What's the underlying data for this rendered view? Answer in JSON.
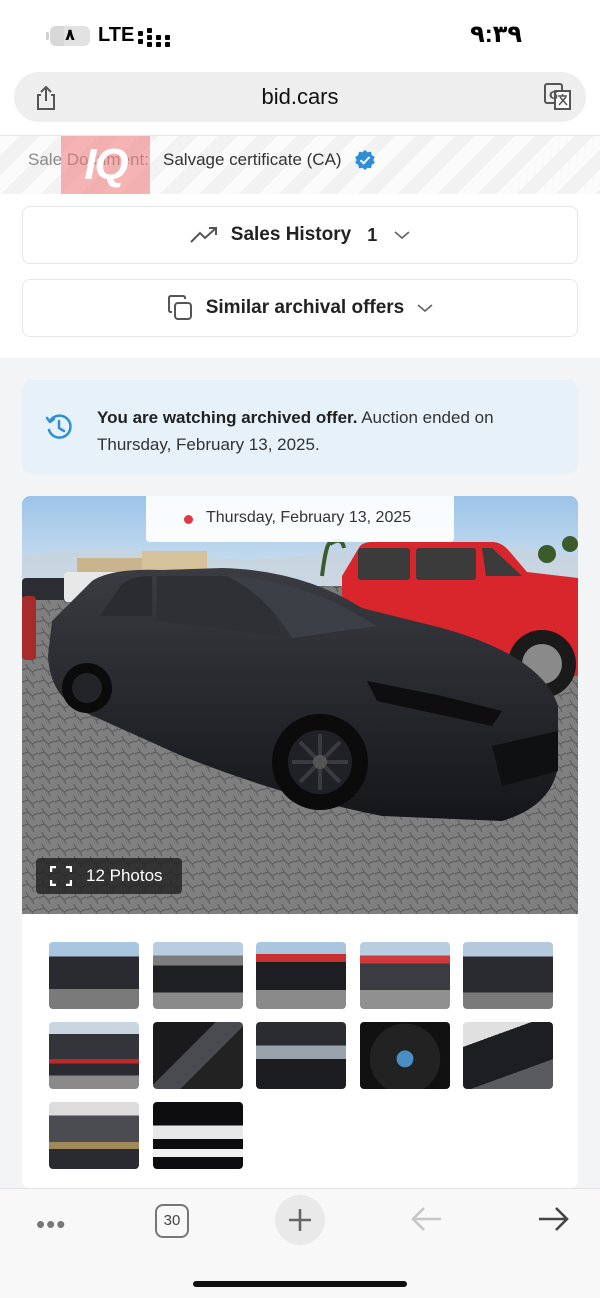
{
  "status_bar": {
    "battery_level": "٨",
    "battery_fill_fraction": 0.35,
    "network": "LTE",
    "time": "٩:٣٩"
  },
  "browser": {
    "url": "bid.cars",
    "open_tabs": "30"
  },
  "sale_document": {
    "label": "Sale Document:",
    "value": "Salvage certificate (CA)",
    "watermark": "IQ"
  },
  "sections": {
    "sales_history": {
      "label": "Sales History",
      "count": "1"
    },
    "similar_offers": {
      "label": "Similar archival offers"
    }
  },
  "notice": {
    "strong": "You are watching archived offer.",
    "text": " Auction ended on Thursday, February 13, 2025."
  },
  "gallery": {
    "date": "Thursday, February 13, 2025",
    "photo_count": "12 Photos",
    "thumbnails": [
      {
        "name": "thumb-front-left"
      },
      {
        "name": "thumb-left-side"
      },
      {
        "name": "thumb-front-angle"
      },
      {
        "name": "thumb-rear-angle"
      },
      {
        "name": "thumb-front"
      },
      {
        "name": "thumb-rear"
      },
      {
        "name": "thumb-interior-front"
      },
      {
        "name": "thumb-dashboard"
      },
      {
        "name": "thumb-instrument-cluster"
      },
      {
        "name": "thumb-interior-rear"
      },
      {
        "name": "thumb-engine-bay"
      },
      {
        "name": "thumb-vin-label"
      }
    ]
  },
  "colors": {
    "accent_blue": "#2f8fd6",
    "notice_bg": "#e6f1fa",
    "live_dot": "#e0383e",
    "truck_red": "#d8262c",
    "car_black": "#1b1c20"
  }
}
